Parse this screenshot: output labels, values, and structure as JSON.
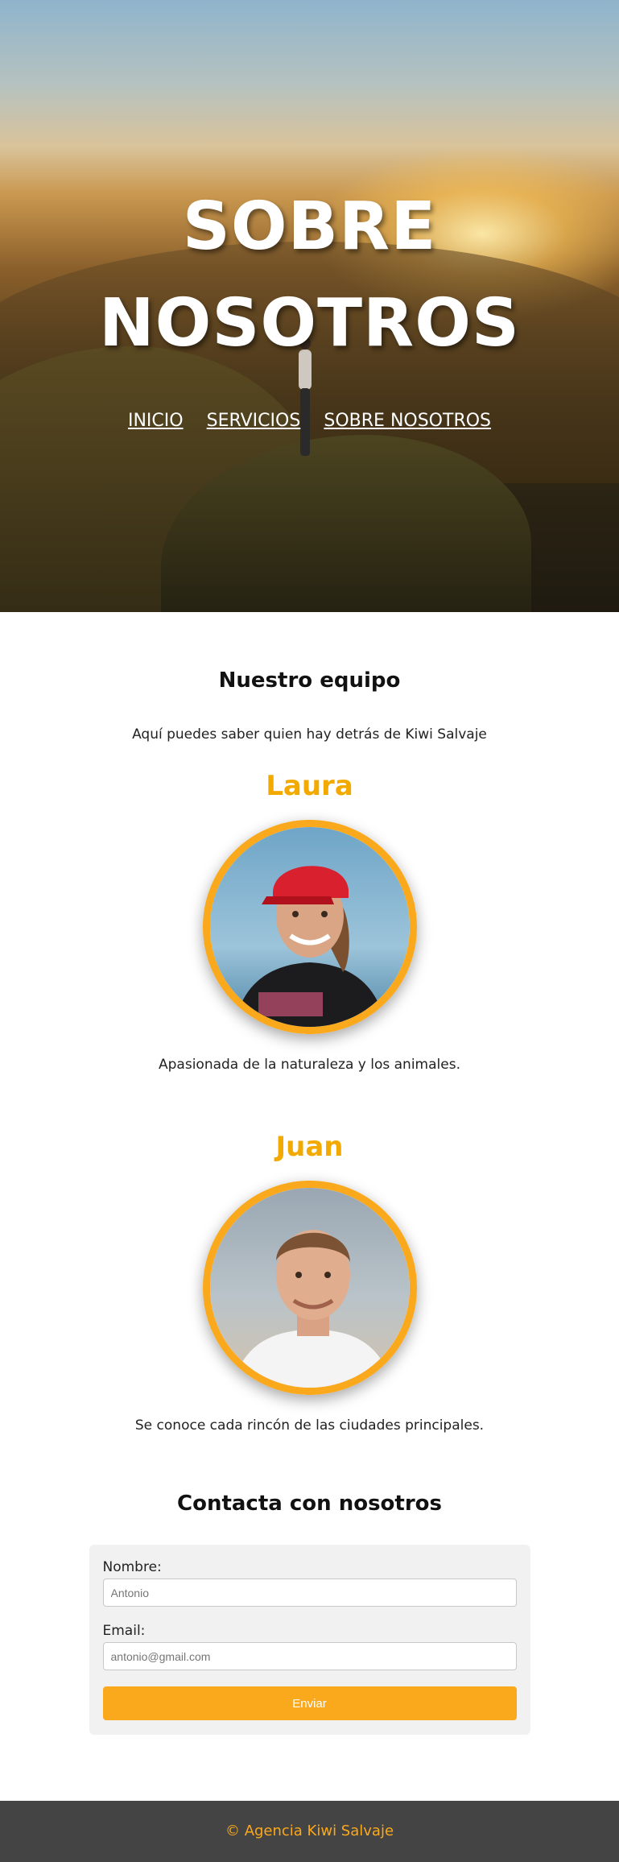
{
  "hero": {
    "title": "SOBRE NOSOTROS",
    "nav": [
      "INICIO",
      "SERVICIOS",
      "SOBRE NOSOTROS"
    ]
  },
  "team": {
    "heading": "Nuestro equipo",
    "intro": "Aquí puedes saber quien hay detrás de Kiwi Salvaje",
    "members": [
      {
        "name": "Laura",
        "description": "Apasionada de la naturaleza y los animales."
      },
      {
        "name": "Juan",
        "description": "Se conoce cada rincón de las ciudades principales."
      }
    ]
  },
  "contact": {
    "heading": "Contacta con nosotros",
    "name_label": "Nombre:",
    "name_placeholder": "Antonio",
    "email_label": "Email:",
    "email_placeholder": "antonio@gmail.com",
    "submit_label": "Enviar"
  },
  "footer": {
    "text": "© Agencia Kiwi Salvaje"
  },
  "colors": {
    "accent": "#fba91c",
    "footer_bg": "#444444"
  }
}
